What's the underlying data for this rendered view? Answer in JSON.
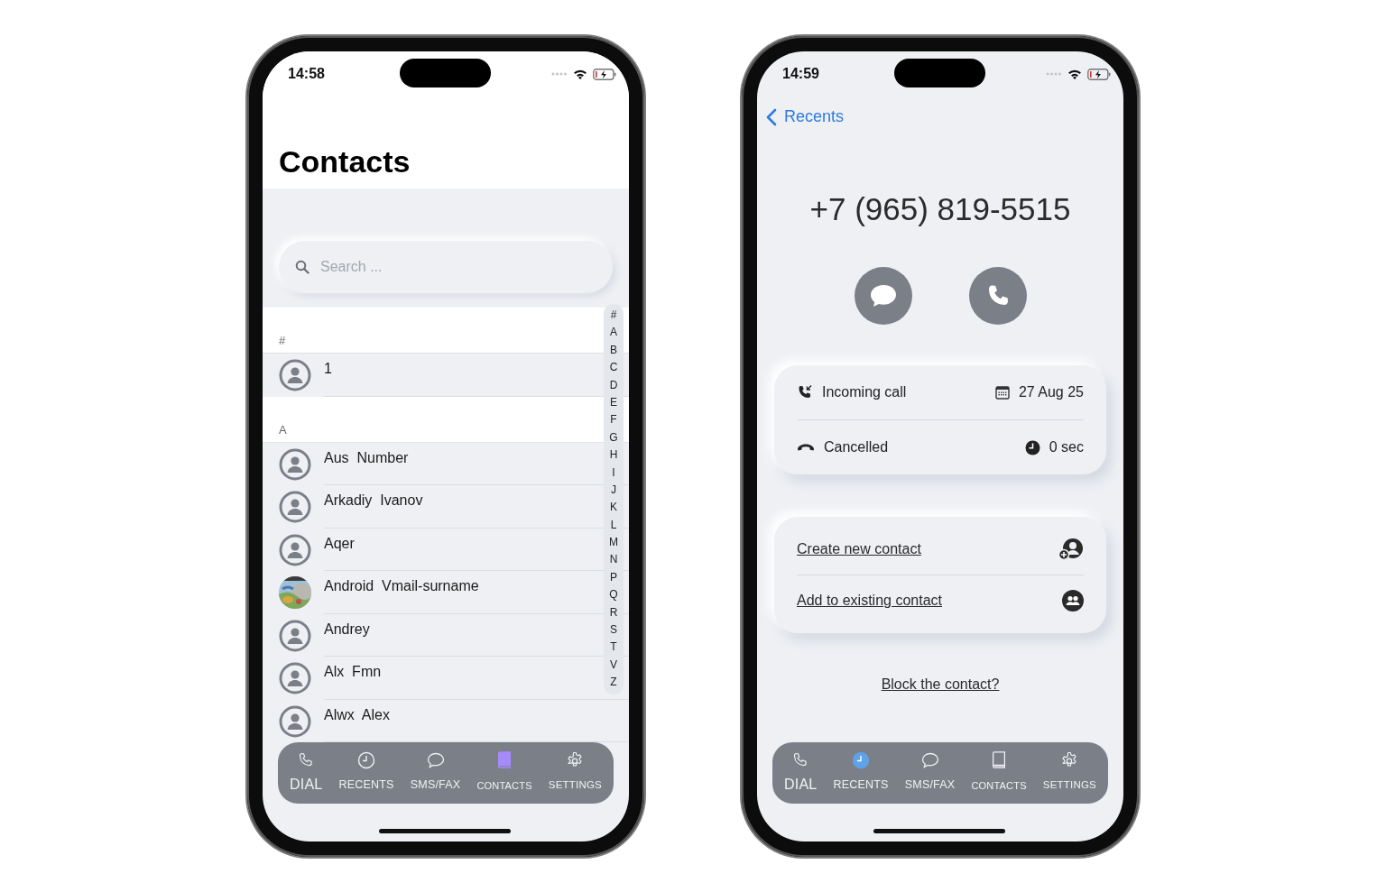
{
  "contacts_screen": {
    "status_time": "14:58",
    "title": "Contacts",
    "search": {
      "placeholder": "Search ..."
    },
    "sections": [
      {
        "letter": "#",
        "contacts": [
          {
            "name": "1",
            "kind": "person"
          }
        ]
      },
      {
        "letter": "A",
        "contacts": [
          {
            "name": "Aus  Number",
            "kind": "person"
          },
          {
            "name": "Arkadiy  Ivanov",
            "kind": "person"
          },
          {
            "name": "Aqer",
            "kind": "person"
          },
          {
            "name": "Android  Vmail-surname",
            "kind": "picture"
          },
          {
            "name": "Andrey",
            "kind": "person"
          },
          {
            "name": "Alx  Fmn",
            "kind": "person"
          },
          {
            "name": "Alwx  Alex",
            "kind": "person"
          }
        ]
      }
    ],
    "index": [
      "#",
      "A",
      "B",
      "C",
      "D",
      "E",
      "F",
      "G",
      "H",
      "I",
      "J",
      "K",
      "L",
      "M",
      "N",
      "P",
      "Q",
      "R",
      "S",
      "T",
      "V",
      "Z"
    ],
    "tabs": [
      {
        "kind": "dial",
        "label": "DIAL",
        "selected": false
      },
      {
        "kind": "recents",
        "label": "RECENTS",
        "selected": false
      },
      {
        "kind": "sms",
        "label": "SMS/FAX",
        "selected": false
      },
      {
        "kind": "contacts",
        "label": "CONTACTS",
        "selected": true
      },
      {
        "kind": "settings",
        "label": "SETTINGS",
        "selected": false
      }
    ]
  },
  "call_screen": {
    "status_time": "14:59",
    "back": "Recents",
    "number": "+7 (965) 819-5515",
    "details": [
      [
        {
          "kind": "incoming",
          "text": "Incoming call"
        },
        {
          "kind": "date",
          "text": "27 Aug 25"
        }
      ],
      [
        {
          "kind": "hangup",
          "text": "Cancelled"
        },
        {
          "kind": "duration",
          "text": "0 sec"
        }
      ]
    ],
    "actions": [
      {
        "kind": "create",
        "label": "Create new contact"
      },
      {
        "kind": "add",
        "label": "Add to existing contact"
      }
    ],
    "block": "Block the contact?",
    "tabs": [
      {
        "kind": "dial",
        "label": "DIAL",
        "selected": false
      },
      {
        "kind": "recents",
        "label": "RECENTS",
        "selected": true
      },
      {
        "kind": "sms",
        "label": "SMS/FAX",
        "selected": false
      },
      {
        "kind": "contacts",
        "label": "CONTACTS",
        "selected": false
      },
      {
        "kind": "settings",
        "label": "SETTINGS",
        "selected": false
      }
    ]
  }
}
